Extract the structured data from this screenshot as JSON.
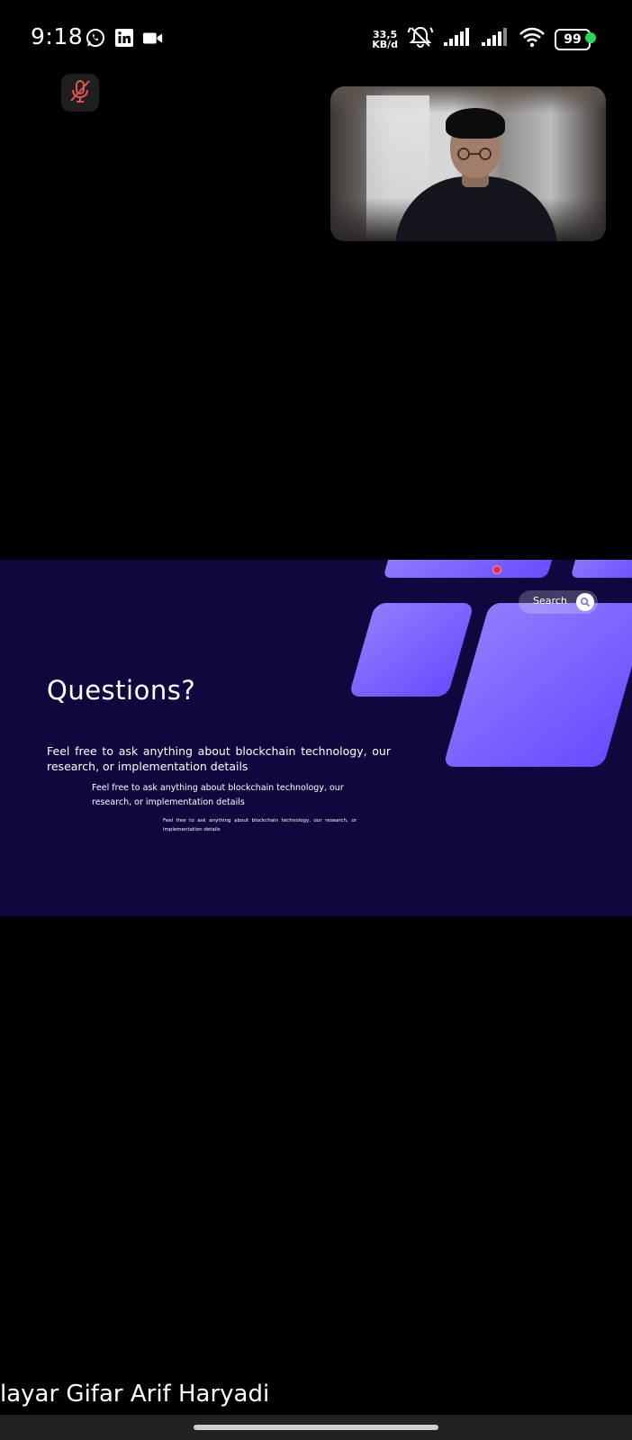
{
  "status_bar": {
    "time": "9:18",
    "app_icons": [
      "whatsapp-icon",
      "linkedin-icon",
      "video-camera-icon"
    ],
    "net_speed_value": "33,5",
    "net_speed_unit": "KB/d",
    "battery": "99",
    "icons": [
      "alarm-off-icon",
      "signal-icon",
      "signal-icon",
      "wifi-icon",
      "battery-icon"
    ],
    "privacy_dot_color": "#2bd557"
  },
  "call": {
    "mic_state": "muted",
    "mic_icon": "mic-off-icon"
  },
  "shared_slide": {
    "search_label": "Search",
    "title": "Questions?",
    "text_large": "Feel free to ask anything about blockchain technology, our research, or implementation details",
    "text_medium": "Feel free to ask anything about blockchain technology, our research, or implementation details",
    "text_small": "Feel free to ask anything about blockchain technology, our research, or implementation details",
    "background_color": "#13053d",
    "accent_color": "#7b63ff"
  },
  "presenter_caption": "layar Gifar Arif Haryadi"
}
